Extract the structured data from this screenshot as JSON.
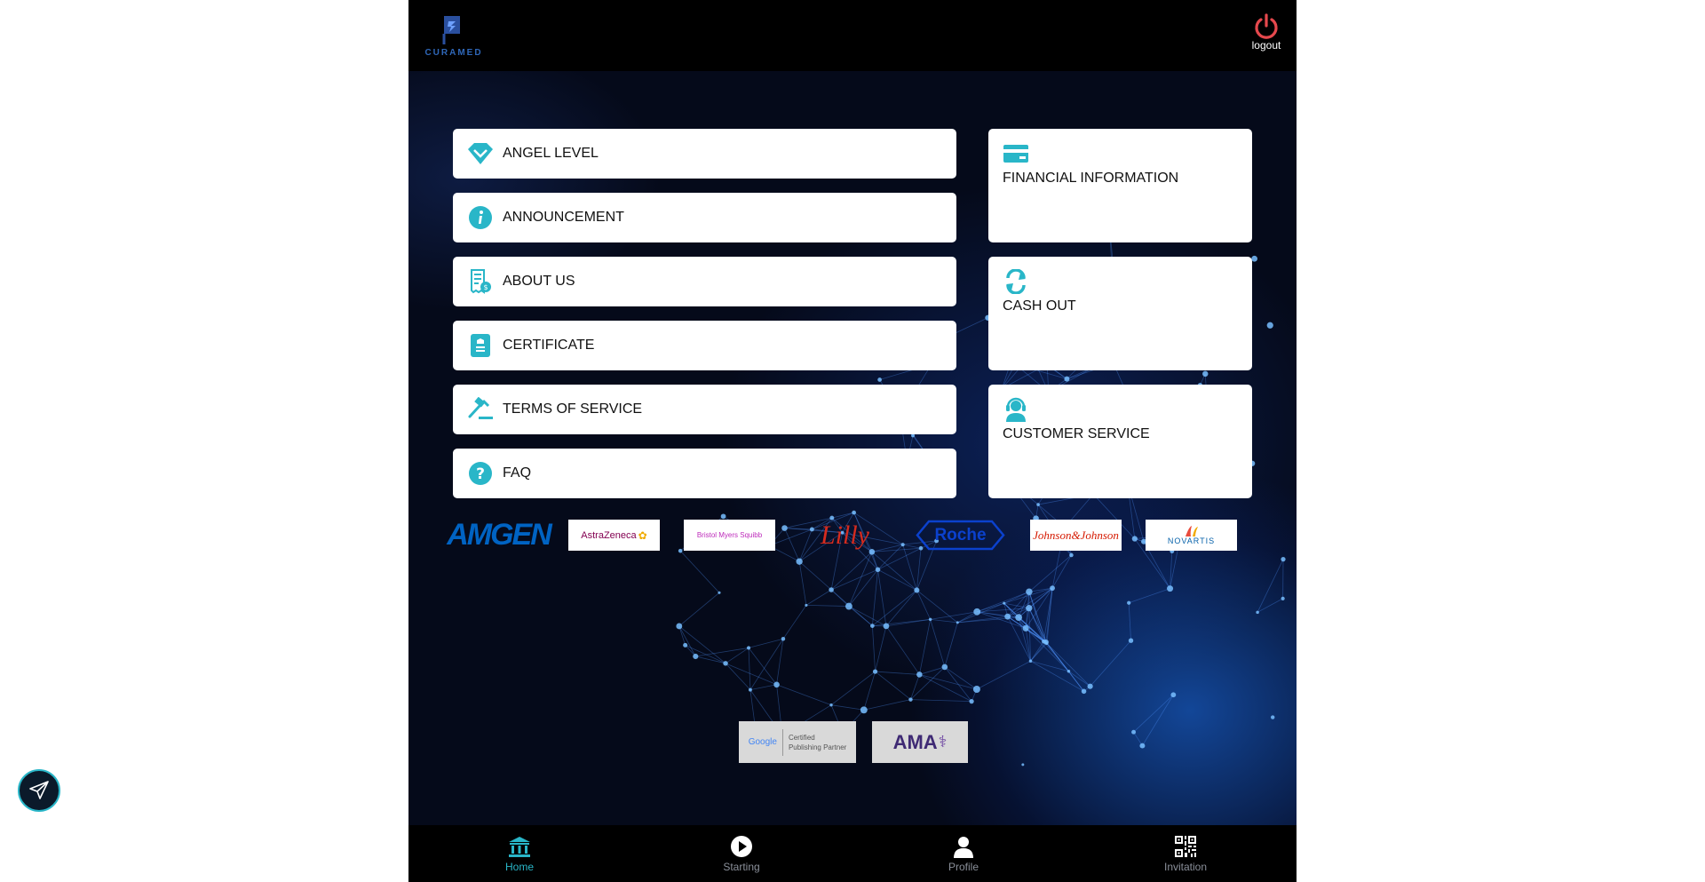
{
  "header": {
    "logo_text": "CURAMED",
    "logout_label": "logout"
  },
  "menu": [
    {
      "label": "ANGEL LEVEL",
      "icon": "diamond-icon"
    },
    {
      "label": "ANNOUNCEMENT",
      "icon": "info-icon"
    },
    {
      "label": "ABOUT US",
      "icon": "receipt-icon"
    },
    {
      "label": "CERTIFICATE",
      "icon": "certificate-icon"
    },
    {
      "label": "TERMS OF SERVICE",
      "icon": "gavel-icon"
    },
    {
      "label": "FAQ",
      "icon": "question-icon"
    }
  ],
  "cards": [
    {
      "label": "FINANCIAL INFORMATION",
      "icon": "credit-card-icon"
    },
    {
      "label": "CASH OUT",
      "icon": "exchange-icon"
    },
    {
      "label": "CUSTOMER SERVICE",
      "icon": "headset-icon"
    }
  ],
  "partners": [
    {
      "label": "AMGEN",
      "color": "#0063c3"
    },
    {
      "label": "AstraZeneca",
      "color": "#830051"
    },
    {
      "label": "Bristol Myers Squibb",
      "color": "#be2bbb"
    },
    {
      "label": "Lilly",
      "color": "#d52b1e"
    },
    {
      "label": "Roche",
      "color": "#0b41cd"
    },
    {
      "label": "Johnson&Johnson",
      "color": "#d51900"
    },
    {
      "label": "NOVARTIS",
      "color": "#0460a9"
    }
  ],
  "certifications": {
    "google_brand": "Google",
    "google_text_line1": "Certified",
    "google_text_line2": "Publishing Partner",
    "ama_text": "AMA"
  },
  "nav": [
    {
      "label": "Home",
      "icon": "bank-icon",
      "active": true
    },
    {
      "label": "Starting",
      "icon": "play-icon",
      "active": false
    },
    {
      "label": "Profile",
      "icon": "user-icon",
      "active": false
    },
    {
      "label": "Invitation",
      "icon": "qr-code-icon",
      "active": false
    }
  ],
  "colors": {
    "accent": "#29b6c8",
    "logout": "#e5484d",
    "background": "#050a1a"
  }
}
